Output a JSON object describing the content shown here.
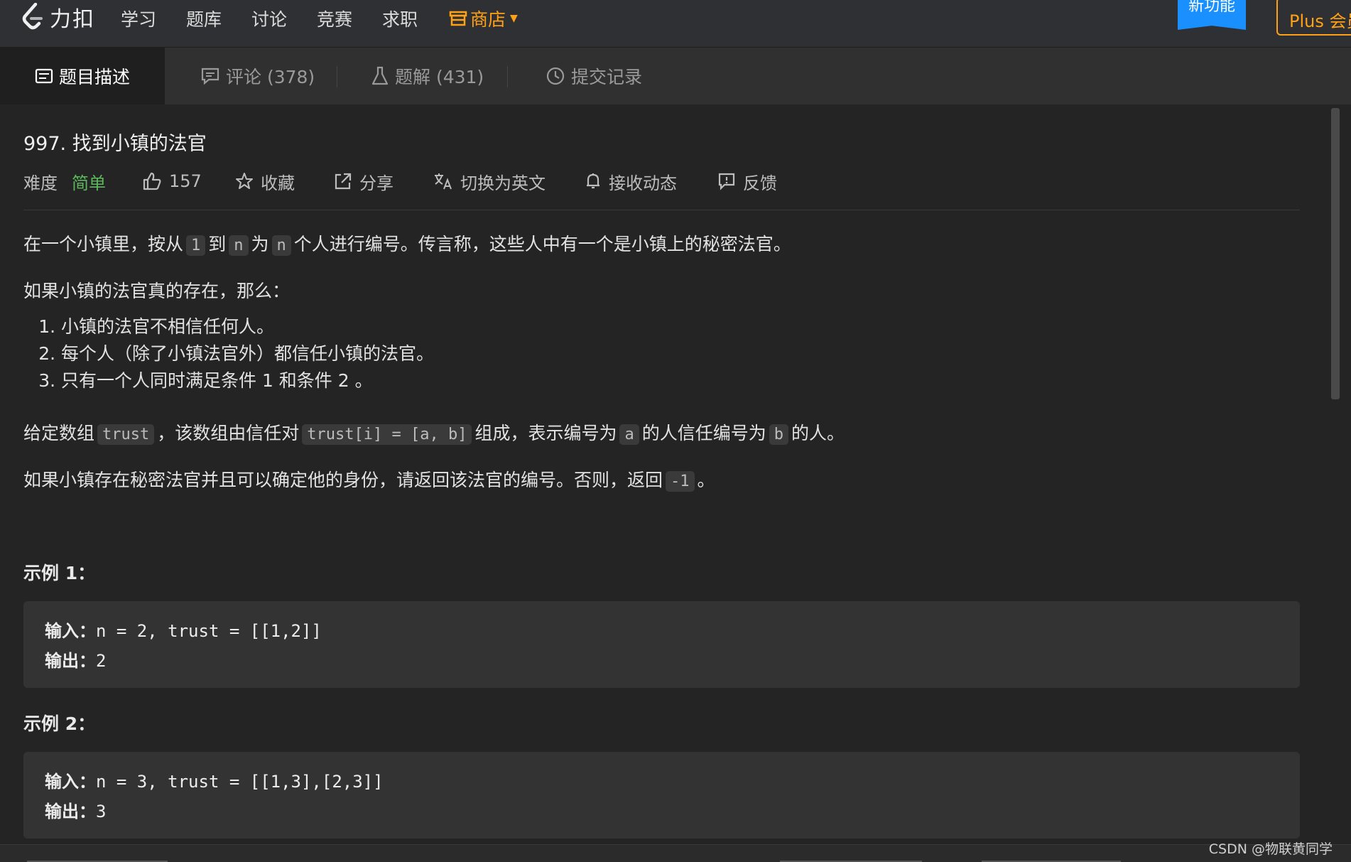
{
  "nav": {
    "brand": "力扣",
    "items": [
      "学习",
      "题库",
      "讨论",
      "竞赛",
      "求职"
    ],
    "store": "商店",
    "new_feature": "新功能",
    "plus": "Plus 会员"
  },
  "tabs": [
    {
      "label": "题目描述",
      "active": true
    },
    {
      "label": "评论 (378)",
      "active": false
    },
    {
      "label": "题解 (431)",
      "active": false
    },
    {
      "label": "提交记录",
      "active": false
    }
  ],
  "problem": {
    "title": "997. 找到小镇的法官",
    "difficulty_label": "难度",
    "difficulty": "简单",
    "likes": "157",
    "actions": {
      "collect": "收藏",
      "share": "分享",
      "translate": "切换为英文",
      "subscribe": "接收动态",
      "feedback": "反馈"
    },
    "p1": {
      "a": "在一个小镇里，按从",
      "c1": "1",
      "b": "到",
      "c2": "n",
      "c": "为",
      "c3": "n",
      "d": "个人进行编号。传言称，这些人中有一个是小镇上的秘密法官。"
    },
    "p2": "如果小镇的法官真的存在，那么：",
    "rules": [
      "小镇的法官不相信任何人。",
      "每个人（除了小镇法官外）都信任小镇的法官。",
      "只有一个人同时满足条件 1 和条件 2 。"
    ],
    "p3": {
      "a": "给定数组",
      "c1": "trust",
      "b": "，该数组由信任对",
      "c2": "trust[i] = [a, b]",
      "c": "组成，表示编号为",
      "c3": "a",
      "d": "的人信任编号为",
      "c4": "b",
      "e": "的人。"
    },
    "p4": {
      "a": "如果小镇存在秘密法官并且可以确定他的身份，请返回该法官的编号。否则，返回",
      "c1": "-1",
      "b": "。"
    },
    "examples": [
      {
        "title": "示例 1：",
        "input_label": "输入：",
        "input": "n = 2, trust = [[1,2]]",
        "output_label": "输出：",
        "output": "2"
      },
      {
        "title": "示例 2：",
        "input_label": "输入：",
        "input": "n = 3, trust = [[1,3],[2,3]]",
        "output_label": "输出：",
        "output": "3"
      }
    ]
  },
  "watermark": "CSDN @物联黄同学",
  "colors": {
    "accent": "#ffa116",
    "easy": "#5cb85c",
    "new_badge": "#1a90ff"
  }
}
